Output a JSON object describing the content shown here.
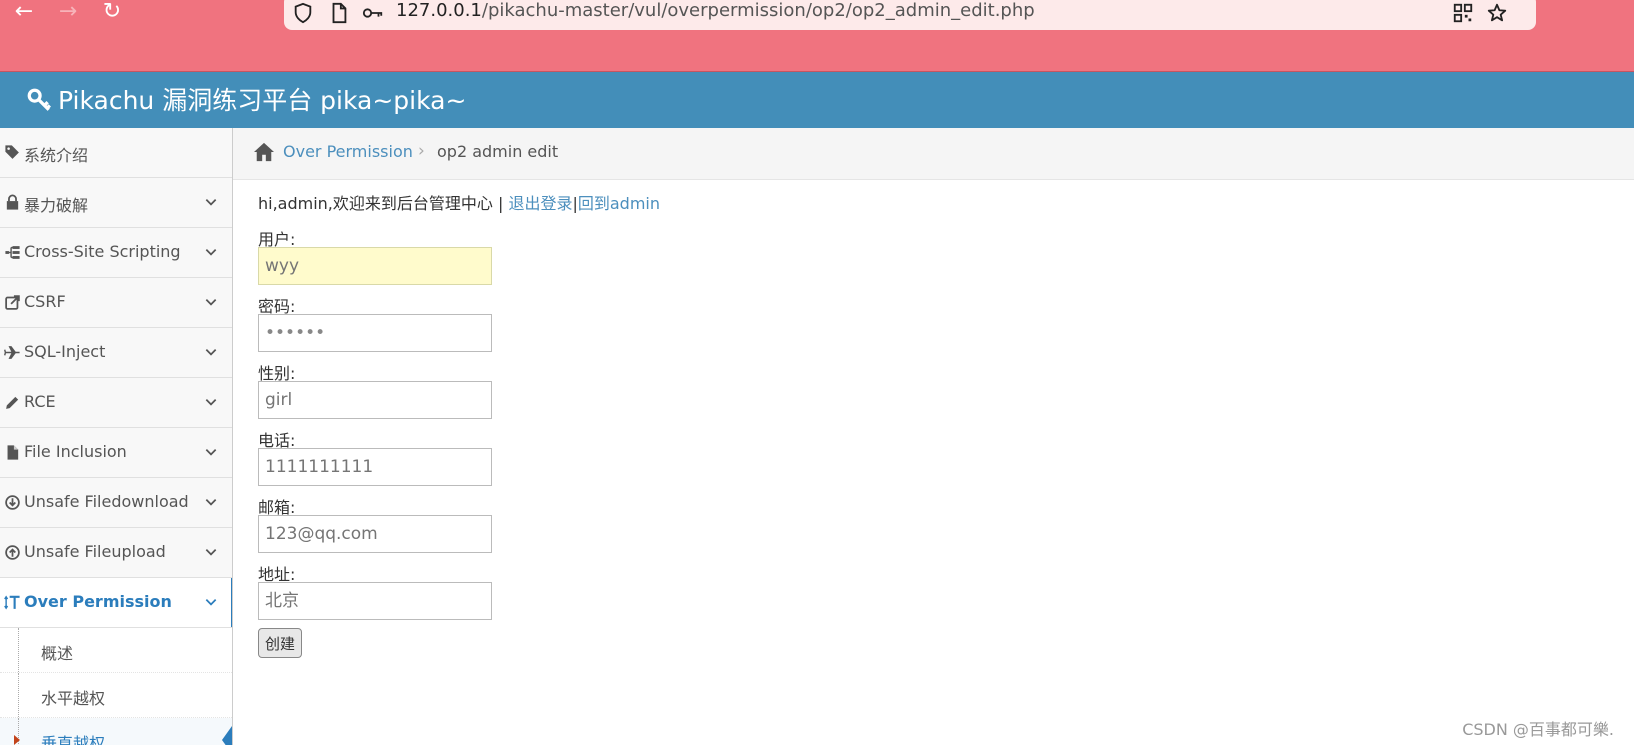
{
  "browser": {
    "url_host": "127.0.0.1",
    "url_path": "/pikachu-master/vul/overpermission/op2/op2_admin_edit.php"
  },
  "app": {
    "title": "Pikachu 漏洞练习平台 pika~pika~"
  },
  "sidebar": {
    "items": [
      {
        "label": "系统介绍",
        "icon": "tags-icon"
      },
      {
        "label": "暴力破解",
        "icon": "lock-icon"
      },
      {
        "label": "Cross-Site Scripting",
        "icon": "sitemap-icon"
      },
      {
        "label": "CSRF",
        "icon": "share-icon"
      },
      {
        "label": "SQL-Inject",
        "icon": "plane-icon"
      },
      {
        "label": "RCE",
        "icon": "pencil-icon"
      },
      {
        "label": "File Inclusion",
        "icon": "file-icon"
      },
      {
        "label": "Unsafe Filedownload",
        "icon": "download-icon"
      },
      {
        "label": "Unsafe Fileupload",
        "icon": "upload-icon"
      },
      {
        "label": "Over Permission",
        "icon": "text-height-icon"
      }
    ],
    "sub_items": [
      {
        "label": "概述"
      },
      {
        "label": "水平越权"
      },
      {
        "label": "垂直越权"
      }
    ]
  },
  "breadcrumb": {
    "parent": "Over Permission",
    "current": "op2 admin edit"
  },
  "welcome": {
    "text": "hi,admin,欢迎来到后台管理中心 | ",
    "logout": "退出登录",
    "separator": "|",
    "back": "回到admin"
  },
  "form": {
    "fields": [
      {
        "label": "用户:",
        "placeholder": "wyy"
      },
      {
        "label": "密码:",
        "value": "123456"
      },
      {
        "label": "性别:",
        "placeholder": "girl"
      },
      {
        "label": "电话:",
        "placeholder": "1111111111"
      },
      {
        "label": "邮箱:",
        "placeholder": "123@qq.com"
      },
      {
        "label": "地址:",
        "placeholder": "北京"
      }
    ],
    "submit_label": "创建"
  },
  "watermark": "CSDN @百事都可樂."
}
